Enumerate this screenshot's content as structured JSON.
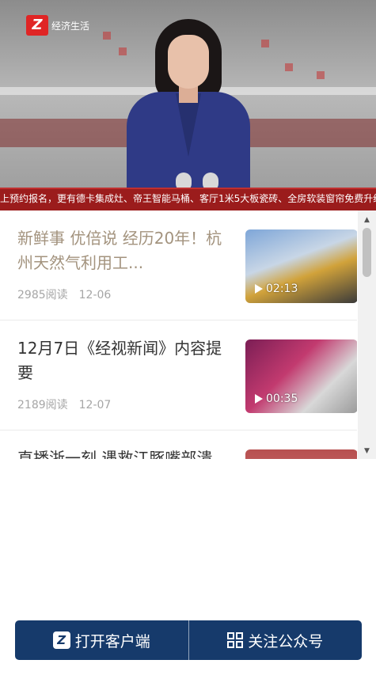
{
  "video": {
    "channel_logo_text": "经济生活",
    "ticker_text": "上预约报名，更有德卡集成灶、帝王智能马桶、客厅1米5大板瓷砖、全房软装窗帘免费升级。"
  },
  "articles": [
    {
      "title": "新鲜事 优倍说 经历20年！杭州天然气利用工...",
      "reads": "2985阅读",
      "date": "12-06",
      "duration": "02:13",
      "visited": true
    },
    {
      "title": "12月7日《经视新闻》内容提要",
      "reads": "2189阅读",
      "date": "12-07",
      "duration": "00:35",
      "visited": false
    },
    {
      "title": "直播浙一刻 遇救江豚嘴部溃",
      "reads": "",
      "date": "",
      "duration": "",
      "visited": false
    }
  ],
  "bottom_bar": {
    "open_app_label": "打开客户端",
    "follow_label": "关注公众号"
  },
  "colors": {
    "bar_bg": "#163a6b",
    "ticker_bg": "#9b1c1c",
    "visited_title": "#a3937e"
  }
}
